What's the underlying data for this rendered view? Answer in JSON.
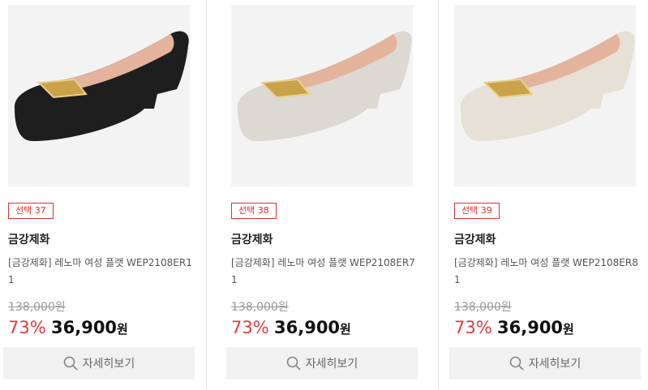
{
  "products": [
    {
      "option_badge": "선택 37",
      "brand": "금강제화",
      "name": "[금강제화] 레노마 여성 플랫 WEP2108ER11",
      "original_price": "138,000원",
      "discount": "73%",
      "sale_price": "36,900",
      "sale_unit": "원",
      "detail_button": "자세히보기",
      "shoe_color": "#1e1e1e"
    },
    {
      "option_badge": "선택 38",
      "brand": "금강제화",
      "name": "[금강제화] 레노마 여성 플랫 WEP2108ER71",
      "original_price": "138,000원",
      "discount": "73%",
      "sale_price": "36,900",
      "sale_unit": "원",
      "detail_button": "자세히보기",
      "shoe_color": "#dcd8d2"
    },
    {
      "option_badge": "선택 39",
      "brand": "금강제화",
      "name": "[금강제화] 레노마 여성 플랫 WEP2108ER81",
      "original_price": "138,000원",
      "discount": "73%",
      "sale_price": "36,900",
      "sale_unit": "원",
      "detail_button": "자세히보기",
      "shoe_color": "#e6e0d6"
    }
  ],
  "icons": {
    "detail_button_icon": "search-icon"
  },
  "colors": {
    "discount": "#e03c3c",
    "badge": "#d9302e"
  }
}
